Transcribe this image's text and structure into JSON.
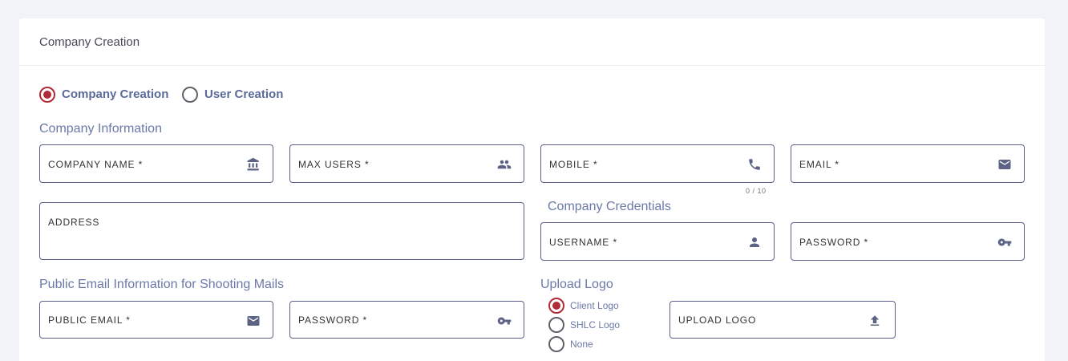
{
  "card": {
    "title": "Company Creation"
  },
  "mode": {
    "options": [
      {
        "label": "Company Creation",
        "checked": true
      },
      {
        "label": "User Creation",
        "checked": false
      }
    ]
  },
  "sections": {
    "company_info": "Company Information",
    "credentials": "Company Credentials",
    "public_email": "Public Email Information for Shooting Mails",
    "upload_logo": "Upload Logo"
  },
  "fields": {
    "company_name": {
      "label": "COMPANY NAME *",
      "icon": "bank-icon"
    },
    "max_users": {
      "label": "MAX USERS *",
      "icon": "people-icon"
    },
    "mobile": {
      "label": "MOBILE *",
      "icon": "phone-icon",
      "counter": "0 / 10"
    },
    "email": {
      "label": "EMAIL *",
      "icon": "mail-icon"
    },
    "address": {
      "label": "ADDRESS"
    },
    "username": {
      "label": "USERNAME *",
      "icon": "person-icon"
    },
    "password": {
      "label": "PASSWORD *",
      "icon": "key-icon"
    },
    "public_email": {
      "label": "PUBLIC EMAIL *",
      "icon": "mail-icon"
    },
    "public_password": {
      "label": "PASSWORD *",
      "icon": "key-icon"
    },
    "upload_logo": {
      "label": "UPLOAD LOGO",
      "icon": "upload-icon"
    }
  },
  "logo_type": {
    "options": [
      {
        "label": "Client Logo",
        "checked": true
      },
      {
        "label": "SHLC Logo",
        "checked": false
      },
      {
        "label": "None",
        "checked": false
      }
    ]
  },
  "colors": {
    "accent": "#b02a37",
    "label_blue": "#6b79a8",
    "field_border": "#5a6088",
    "icon": "#5c6384"
  }
}
